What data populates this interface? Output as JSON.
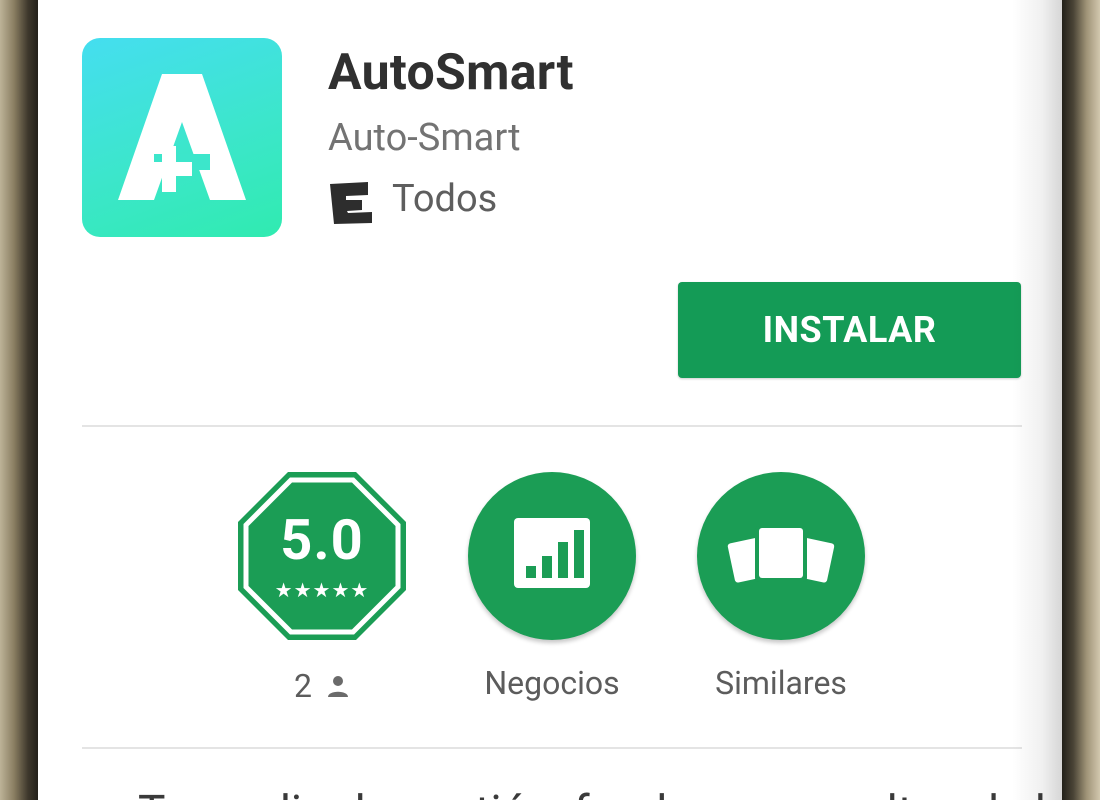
{
  "app": {
    "title": "AutoSmart",
    "developer": "Auto-Smart",
    "content_rating": "Todos",
    "install_label": "INSTALAR"
  },
  "badges": {
    "rating_value": "5.0",
    "stars": "★★★★★",
    "reviews_count": "2",
    "category_label": "Negocios",
    "similar_label": "Similares"
  },
  "description_partial": "Tu medio de gestión, fondos y consultas de la flota",
  "icons": {
    "app_icon": "autosmart-logo-icon",
    "esrb": "esrb-e-icon",
    "reviews": "person-icon",
    "category": "bar-chart-icon",
    "similar": "stacked-cards-icon"
  },
  "colors": {
    "install_green": "#149b56",
    "badge_green": "#1b9d55",
    "icon_gradient_top": "#45def0",
    "icon_gradient_bottom": "#30ebb0"
  }
}
